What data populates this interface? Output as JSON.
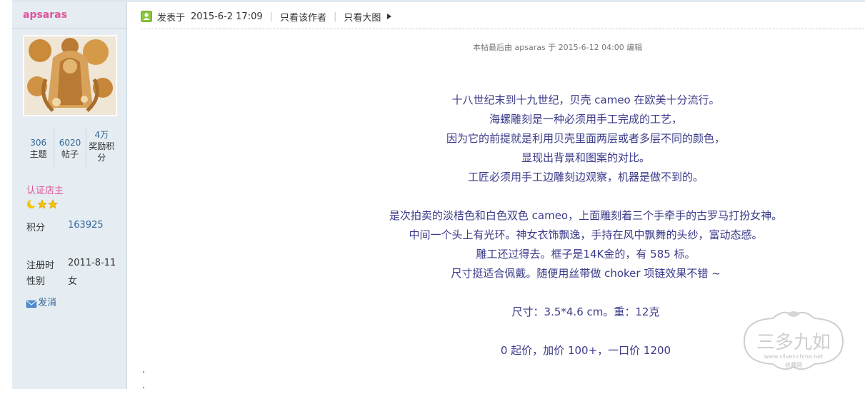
{
  "sidebar": {
    "username": "apsaras",
    "stats": [
      {
        "num": "306",
        "label": "主题"
      },
      {
        "num": "6020",
        "label": "帖子"
      },
      {
        "num": "4万",
        "label": "奖励积分"
      }
    ],
    "rank": "认证店主",
    "points_label": "积分",
    "points_value": "163925",
    "register_label": "注册时",
    "register_value": "2011-8-11",
    "gender_label": "性别",
    "gender_value": "女",
    "message_label": "发消"
  },
  "postbar": {
    "posted_label": "发表于",
    "posted_time": "2015-6-2 17:09",
    "only_author": "只看该作者",
    "big_image": "只看大图"
  },
  "edit_note": "本帖最后由  apsaras 于  2015-6-12 04:00 编辑",
  "content": {
    "lines_1": [
      "十八世纪末到十九世纪，贝壳 cameo 在欧美十分流行。",
      "海螺雕刻是一种必须用手工完成的工艺，",
      "因为它的前提就是利用贝壳里面两层或者多层不同的颜色，",
      "显现出背景和图案的对比。",
      "工匠必须用手工边雕刻边观察，机器是做不到的。"
    ],
    "lines_2": [
      "是次拍卖的淡桔色和白色双色 cameo，上面雕刻着三个手牵手的古罗马打扮女神。",
      "中间一个头上有光环。神女衣饰飘逸，手持在风中飘舞的头纱，富动态感。",
      "雕工还过得去。框子是14K金的，有 585 标。",
      "尺寸挺适合佩戴。随便用丝带做 choker 项链效果不错 ~"
    ],
    "size_line": "尺寸：3.5*4.6 cm。重：12克",
    "price_line": "0 起价，加价 100+，一口价 1200"
  },
  "dots": [
    ".",
    "."
  ],
  "watermark": {
    "title": "三多九如",
    "url": "www.silver-china.net",
    "sub": "收藏网"
  },
  "colors": {
    "accent_pink": "#e0529b",
    "link_blue": "#336699",
    "content_text": "#3a3a8a",
    "sidebar_bg": "#e5edf2"
  },
  "icons": {
    "post_icon": "user-post-icon",
    "arrow": "triangle-right-icon",
    "stars": [
      "moon-icon",
      "star-icon",
      "star-icon"
    ],
    "message": "envelope-icon"
  }
}
